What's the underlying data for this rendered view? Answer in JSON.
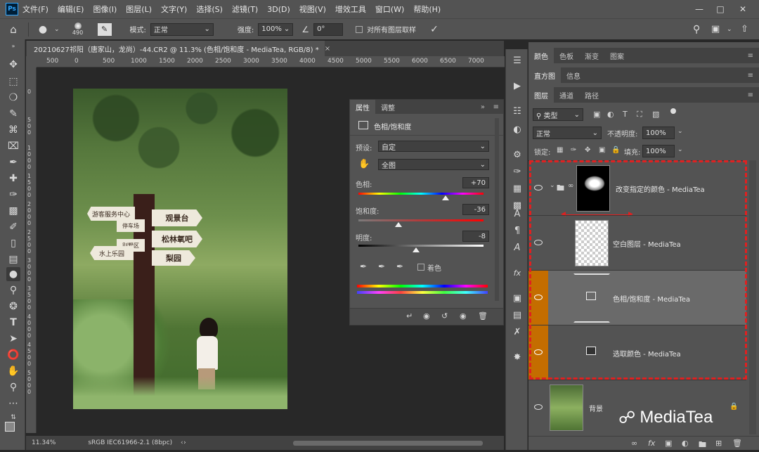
{
  "app": {
    "logo": "Ps"
  },
  "menu": [
    "文件(F)",
    "编辑(E)",
    "图像(I)",
    "图层(L)",
    "文字(Y)",
    "选择(S)",
    "滤镜(T)",
    "3D(D)",
    "视图(V)",
    "增效工具",
    "窗口(W)",
    "帮助(H)"
  ],
  "options": {
    "brush_size": "490",
    "mode_label": "模式:",
    "mode_value": "正常",
    "strength_label": "强度:",
    "strength_value": "100%",
    "angle_value": "0°",
    "sample_all_label": "对所有图层取样"
  },
  "document": {
    "tab_title": "20210627祁阳（唐家山，龙尚）-44.CR2 @ 11.3% (色相/饱和度 - MediaTea, RGB/8) *",
    "ruler_h": [
      "500",
      "0",
      "500",
      "1000",
      "1500",
      "2000",
      "2500",
      "3000",
      "3500",
      "4000",
      "4500",
      "5000",
      "5500",
      "6000",
      "6500",
      "7000"
    ],
    "ruler_v": [
      "0",
      "5 0 0",
      "1 0 0 0",
      "1 5 0 0",
      "2 0 0 0",
      "2 5 0 0",
      "3 0 0 0",
      "3 5 0 0",
      "4 0 0 0",
      "4 5 0 0",
      "5 0 0 0"
    ],
    "signs": [
      "游客服务中心",
      "观景台",
      "停车场",
      "松林氧吧",
      "别墅区",
      "水上乐园",
      "梨园"
    ]
  },
  "status": {
    "zoom": "11.34%",
    "profile": "sRGB IEC61966-2.1 (8bpc)"
  },
  "properties": {
    "tabs": [
      "属性",
      "调整"
    ],
    "title": "色相/饱和度",
    "preset_label": "预设:",
    "preset_value": "自定",
    "channel_value": "全图",
    "hue_label": "色相:",
    "hue_value": "+70",
    "hue_level": 70,
    "saturation_label": "饱和度:",
    "saturation_value": "-36",
    "saturation_level": -36,
    "lightness_label": "明度:",
    "lightness_value": "-8",
    "lightness_level": -8,
    "colorize_label": "着色"
  },
  "panels": {
    "top_tabs": [
      "颜色",
      "色板",
      "渐变",
      "图案"
    ],
    "mid_tabs": [
      "直方图",
      "信息"
    ],
    "layer_tabs": [
      "图层",
      "通道",
      "路径"
    ],
    "filter_label": "类型",
    "blend_mode": "正常",
    "opacity_label": "不透明度:",
    "opacity_value": "100%",
    "lock_label": "锁定:",
    "fill_label": "填充:",
    "fill_value": "100%"
  },
  "layers": [
    {
      "name": "改变指定的颜色 - MediaTea"
    },
    {
      "name": "空白图层 - MediaTea"
    },
    {
      "name": "色相/饱和度 - MediaTea"
    },
    {
      "name": "选取颜色 - MediaTea"
    },
    {
      "name": "背景"
    }
  ],
  "watermark": "MediaTea",
  "colors": {
    "accent_orange": "#c46d00",
    "highlight_red": "#e02020"
  }
}
